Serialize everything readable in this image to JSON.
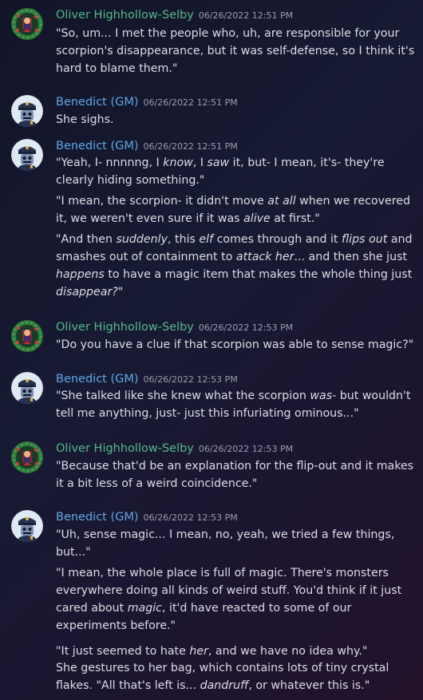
{
  "groups": [
    {
      "author": "Oliver Highhollow-Selby",
      "timestamp": "06/26/2022 12:51 PM",
      "messages": [
        "\"So, um... I met the people who, uh, are responsible for your scorpion's disappearance, but it was self-defense, so I think it's hard to blame them.\""
      ]
    },
    {
      "author": "Benedict (GM)",
      "timestamp": "06/26/2022 12:51 PM",
      "messages": [
        "She sighs."
      ]
    },
    {
      "author": "Benedict (GM)",
      "timestamp": "06/26/2022 12:51 PM",
      "messages": [
        "\"Yeah, I- nnnnng, I *know*, I *saw* it, but- I mean, it's- they're clearly hiding something.\"",
        "\"I mean, the scorpion- it didn't move *at all* when we recovered it, we weren't even sure if it was *alive* at first.\"",
        "\"And then *suddenly*, this *elf* comes through and it *flips out* and smashes out of containment to *attack her*... and then she just *happens* to have a magic item that makes the whole thing just *disappear?*\""
      ]
    },
    {
      "author": "Oliver Highhollow-Selby",
      "timestamp": "06/26/2022 12:53 PM",
      "messages": [
        "\"Do you have a clue if that scorpion was able to sense magic?\""
      ]
    },
    {
      "author": "Benedict (GM)",
      "timestamp": "06/26/2022 12:53 PM",
      "messages": [
        "\"She talked like she knew what the scorpion *was*- but wouldn't tell me anything, just- just this infuriating ominous...\""
      ]
    },
    {
      "author": "Oliver Highhollow-Selby",
      "timestamp": "06/26/2022 12:53 PM",
      "messages": [
        "\"Because that'd be an explanation for the flip-out and it makes it a bit less of a weird coincidence.\""
      ]
    },
    {
      "author": "Benedict (GM)",
      "timestamp": "06/26/2022 12:53 PM",
      "messages": [
        "\"Uh, sense magic... I mean, no, yeah, we tried a few things, but...\"",
        "\"I mean, the whole place is full of magic. There's monsters everywhere doing all kinds of weird stuff. You'd think if it just cared about *magic*, it'd have reacted to some of our experiments before.\"",
        "\"It just seemed to hate *her*, and we have no idea why.\"",
        "She gestures to her bag, which contains lots of tiny crystal flakes. \"All that's left is... *dandruff*, or whatever this is.\""
      ]
    }
  ],
  "colors": {
    "oliver_name": "#56b98a",
    "benedict_name": "#5ea9e6",
    "message_text": "#dcdde6",
    "timestamp": "#9a9cae"
  },
  "icons": {
    "oliver_avatar": "wreath-avatar-icon",
    "benedict_avatar": "police-officer-avatar-icon"
  }
}
